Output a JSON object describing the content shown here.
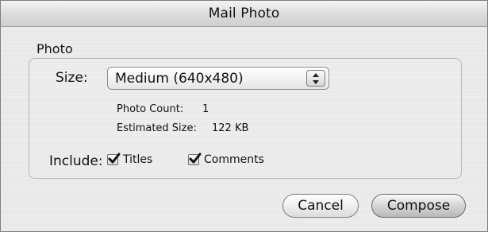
{
  "window": {
    "title": "Mail Photo"
  },
  "photo_section": {
    "title": "Photo",
    "size_label": "Size:",
    "size_value": "Medium (640x480)",
    "photo_count_label": "Photo Count:",
    "photo_count_value": "1",
    "estimated_size_label": "Estimated Size:",
    "estimated_size_value": "122 KB",
    "include_label": "Include:",
    "titles_label": "Titles",
    "comments_label": "Comments",
    "titles_checked": true,
    "comments_checked": true
  },
  "buttons": {
    "cancel": "Cancel",
    "compose": "Compose"
  },
  "icons": {
    "popup_stepper": "up-down-arrows-icon",
    "checkmark": "checkmark-icon"
  },
  "colors": {
    "window_bg": "#ececec",
    "border": "#7f7f7f",
    "text": "#111111"
  }
}
